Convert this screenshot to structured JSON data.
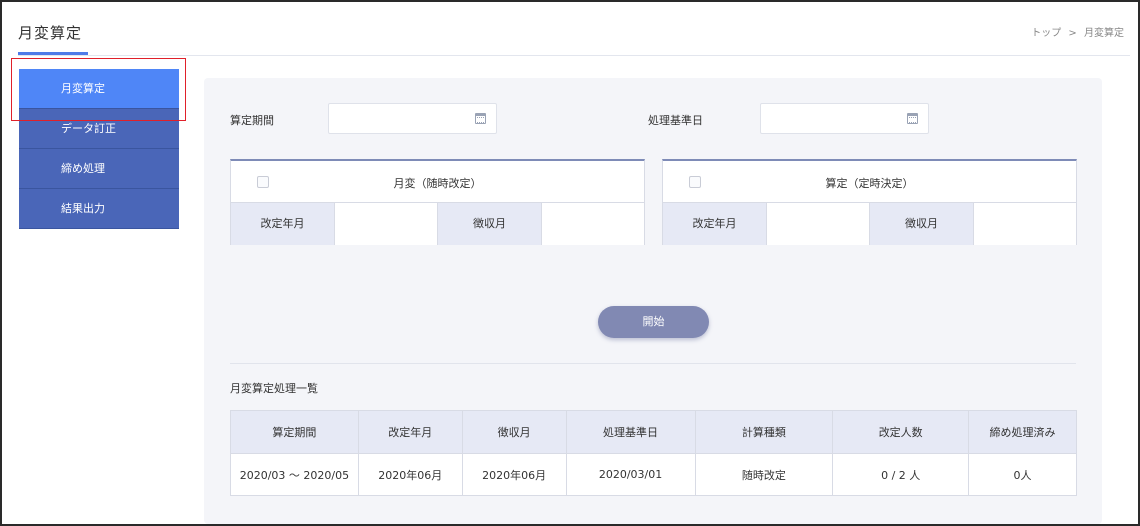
{
  "header": {
    "title": "月変算定",
    "breadcrumb": {
      "home": "トップ",
      "separator": ">",
      "current": "月変算定"
    }
  },
  "sidebar": {
    "items": [
      {
        "label": "月変算定",
        "active": true
      },
      {
        "label": "データ訂正",
        "active": false
      },
      {
        "label": "締め処理",
        "active": false
      },
      {
        "label": "結果出力",
        "active": false
      }
    ]
  },
  "form": {
    "period_label": "算定期間",
    "period_value": "",
    "base_date_label": "処理基準日",
    "base_date_value": ""
  },
  "monthly_change": {
    "checkbox_label": "月変（随時改定）",
    "checked": false,
    "revision_month_label": "改定年月",
    "revision_month_value": "",
    "collection_month_label": "徴収月",
    "collection_month_value": ""
  },
  "calculation": {
    "checkbox_label": "算定（定時決定）",
    "checked": false,
    "revision_month_label": "改定年月",
    "revision_month_value": "",
    "collection_month_label": "徴収月",
    "collection_month_value": ""
  },
  "start_button": {
    "label": "開始"
  },
  "list": {
    "title": "月変算定処理一覧",
    "columns": [
      "算定期間",
      "改定年月",
      "徴収月",
      "処理基準日",
      "計算種類",
      "改定人数",
      "締め処理済み"
    ],
    "rows": [
      [
        "2020/03 ～ 2020/05",
        "2020年06月",
        "2020年06月",
        "2020/03/01",
        "随時改定",
        "0 / 2 人",
        "0人"
      ]
    ]
  },
  "colors": {
    "accent": "#4f86f7",
    "sidebar": "#4a66b8",
    "button": "#8189b3",
    "highlight": "#e0202a"
  }
}
